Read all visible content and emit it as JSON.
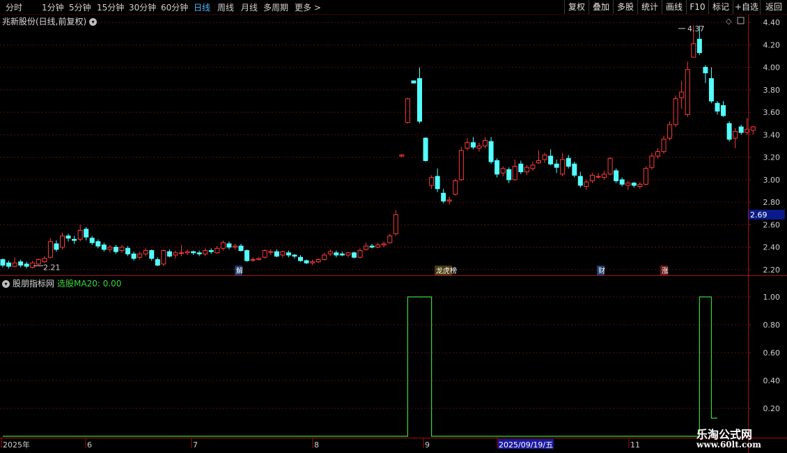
{
  "toolbar": {
    "periods": [
      "分时",
      "1分钟",
      "5分钟",
      "15分钟",
      "30分钟",
      "60分钟",
      "日线",
      "周线",
      "月线",
      "多周期",
      "更多 >"
    ],
    "active_period": "日线",
    "right_buttons": [
      "复权",
      "叠加",
      "多股",
      "统计",
      "画线",
      "F10",
      "标记",
      "+自选",
      "返回"
    ]
  },
  "main_chart": {
    "title": "兆新股份(日线,前复权)",
    "y_ticks": [
      "4.40",
      "4.20",
      "4.00",
      "3.80",
      "3.60",
      "3.40",
      "3.20",
      "3.00",
      "2.80",
      "2.60",
      "2.40",
      "2.20"
    ],
    "current_price": "2.69",
    "low_label": "2.21",
    "high_label": "4.37",
    "event_markers": [
      "解",
      "龙虎榜",
      "财",
      "涨"
    ]
  },
  "indicator": {
    "name": "股朋指标网",
    "value_label": "选股MA20: 0.00",
    "y_ticks": [
      "1.00",
      "0.80",
      "0.60",
      "0.40",
      "0.20"
    ]
  },
  "x_axis": {
    "labels": [
      "2025年",
      "6",
      "7",
      "8",
      "9",
      "2025/09/19/五",
      "11"
    ]
  },
  "watermark": {
    "line1": "乐淘公式网",
    "line2": "www.60lt.com"
  },
  "chart_data": [
    {
      "type": "candlestick",
      "title": "兆新股份(日线,前复权)",
      "ylim": [
        2.15,
        4.45
      ],
      "up_color": "#ff3b3b",
      "down_color": "#54ffff",
      "candles": [
        [
          2.29,
          2.24,
          2.3,
          2.22
        ],
        [
          2.26,
          2.23,
          2.28,
          2.21
        ],
        [
          2.23,
          2.26,
          2.31,
          2.22
        ],
        [
          2.27,
          2.24,
          2.29,
          2.22
        ],
        [
          2.25,
          2.23,
          2.27,
          2.21
        ],
        [
          2.22,
          2.26,
          2.28,
          2.21
        ],
        [
          2.25,
          2.29,
          2.3,
          2.24
        ],
        [
          2.27,
          2.3,
          2.32,
          2.26
        ],
        [
          2.31,
          2.45,
          2.48,
          2.3
        ],
        [
          2.43,
          2.38,
          2.46,
          2.36
        ],
        [
          2.4,
          2.5,
          2.53,
          2.38
        ],
        [
          2.5,
          2.48,
          2.52,
          2.45
        ],
        [
          2.47,
          2.46,
          2.5,
          2.43
        ],
        [
          2.47,
          2.55,
          2.6,
          2.45
        ],
        [
          2.56,
          2.49,
          2.58,
          2.46
        ],
        [
          2.48,
          2.44,
          2.5,
          2.42
        ],
        [
          2.45,
          2.41,
          2.47,
          2.39
        ],
        [
          2.42,
          2.38,
          2.44,
          2.36
        ],
        [
          2.38,
          2.4,
          2.42,
          2.35
        ],
        [
          2.4,
          2.36,
          2.42,
          2.34
        ],
        [
          2.37,
          2.4,
          2.42,
          2.35
        ],
        [
          2.39,
          2.34,
          2.41,
          2.32
        ],
        [
          2.34,
          2.3,
          2.36,
          2.28
        ],
        [
          2.31,
          2.34,
          2.36,
          2.29
        ],
        [
          2.34,
          2.37,
          2.39,
          2.32
        ],
        [
          2.37,
          2.3,
          2.38,
          2.28
        ],
        [
          2.29,
          2.24,
          2.31,
          2.23
        ],
        [
          2.25,
          2.37,
          2.38,
          2.23
        ],
        [
          2.36,
          2.32,
          2.38,
          2.31
        ],
        [
          2.33,
          2.35,
          2.37,
          2.3
        ],
        [
          2.35,
          2.35,
          2.42,
          2.32
        ],
        [
          2.35,
          2.36,
          2.38,
          2.33
        ],
        [
          2.36,
          2.35,
          2.37,
          2.33
        ],
        [
          2.35,
          2.34,
          2.37,
          2.32
        ],
        [
          2.34,
          2.37,
          2.39,
          2.32
        ],
        [
          2.37,
          2.36,
          2.39,
          2.34
        ],
        [
          2.35,
          2.39,
          2.41,
          2.34
        ],
        [
          2.39,
          2.44,
          2.46,
          2.37
        ],
        [
          2.43,
          2.4,
          2.45,
          2.38
        ],
        [
          2.4,
          2.41,
          2.43,
          2.38
        ],
        [
          2.41,
          2.37,
          2.43,
          2.36
        ],
        [
          2.37,
          2.28,
          2.38,
          2.27
        ],
        [
          2.29,
          2.29,
          2.31,
          2.27
        ],
        [
          2.29,
          2.3,
          2.31,
          2.28
        ],
        [
          2.31,
          2.37,
          2.38,
          2.3
        ],
        [
          2.36,
          2.36,
          2.38,
          2.33
        ],
        [
          2.36,
          2.32,
          2.38,
          2.31
        ],
        [
          2.33,
          2.36,
          2.37,
          2.31
        ],
        [
          2.35,
          2.33,
          2.37,
          2.31
        ],
        [
          2.33,
          2.32,
          2.34,
          2.3
        ],
        [
          2.31,
          2.28,
          2.33,
          2.27
        ],
        [
          2.28,
          2.26,
          2.29,
          2.25
        ],
        [
          2.26,
          2.27,
          2.29,
          2.24
        ],
        [
          2.27,
          2.29,
          2.3,
          2.26
        ],
        [
          2.29,
          2.33,
          2.35,
          2.28
        ],
        [
          2.34,
          2.36,
          2.38,
          2.32
        ],
        [
          2.35,
          2.33,
          2.37,
          2.31
        ],
        [
          2.34,
          2.33,
          2.36,
          2.32
        ],
        [
          2.33,
          2.35,
          2.36,
          2.31
        ],
        [
          2.35,
          2.31,
          2.36,
          2.3
        ],
        [
          2.31,
          2.37,
          2.39,
          2.3
        ],
        [
          2.38,
          2.41,
          2.44,
          2.37
        ],
        [
          2.41,
          2.4,
          2.43,
          2.39
        ],
        [
          2.4,
          2.42,
          2.44,
          2.39
        ],
        [
          2.42,
          2.43,
          2.45,
          2.4
        ],
        [
          2.44,
          2.5,
          2.52,
          2.43
        ],
        [
          2.52,
          2.69,
          2.73,
          2.5
        ],
        [
          3.21,
          3.22,
          3.23,
          3.2
        ],
        [
          3.51,
          3.72,
          3.73,
          3.5
        ],
        [
          3.88,
          3.86,
          3.88,
          3.86
        ],
        [
          3.9,
          3.52,
          4.0,
          3.5
        ],
        [
          3.37,
          3.17,
          3.38,
          3.16
        ],
        [
          2.95,
          3.02,
          3.04,
          2.92
        ],
        [
          3.03,
          2.92,
          3.1,
          2.89
        ],
        [
          2.88,
          2.81,
          2.92,
          2.79
        ],
        [
          2.81,
          2.82,
          2.85,
          2.78
        ],
        [
          2.87,
          2.99,
          3.01,
          2.86
        ],
        [
          3.0,
          3.26,
          3.29,
          2.99
        ],
        [
          3.28,
          3.33,
          3.37,
          3.26
        ],
        [
          3.33,
          3.29,
          3.38,
          3.27
        ],
        [
          3.28,
          3.3,
          3.33,
          3.25
        ],
        [
          3.3,
          3.35,
          3.38,
          3.28
        ],
        [
          3.34,
          3.16,
          3.38,
          3.14
        ],
        [
          3.17,
          3.05,
          3.19,
          3.02
        ],
        [
          3.06,
          3.1,
          3.12,
          3.03
        ],
        [
          3.09,
          3.0,
          3.11,
          2.97
        ],
        [
          3.0,
          3.12,
          3.18,
          2.99
        ],
        [
          3.14,
          3.07,
          3.17,
          3.05
        ],
        [
          3.07,
          3.11,
          3.13,
          3.04
        ],
        [
          3.1,
          3.13,
          3.16,
          3.08
        ],
        [
          3.15,
          3.17,
          3.26,
          3.14
        ],
        [
          3.18,
          3.22,
          3.24,
          3.15
        ],
        [
          3.21,
          3.14,
          3.27,
          3.13
        ],
        [
          3.14,
          3.11,
          3.18,
          3.06
        ],
        [
          3.05,
          3.18,
          3.24,
          3.03
        ],
        [
          3.19,
          3.12,
          3.22,
          3.1
        ],
        [
          3.14,
          3.04,
          3.16,
          3.02
        ],
        [
          3.03,
          2.95,
          3.07,
          2.93
        ],
        [
          2.94,
          2.98,
          3.0,
          2.91
        ],
        [
          2.99,
          3.04,
          3.06,
          2.97
        ],
        [
          3.03,
          3.03,
          3.06,
          3.01
        ],
        [
          3.02,
          3.05,
          3.08,
          3.0
        ],
        [
          3.05,
          3.19,
          3.2,
          3.04
        ],
        [
          3.08,
          2.99,
          3.1,
          2.97
        ],
        [
          3.0,
          2.96,
          3.02,
          2.94
        ],
        [
          2.95,
          2.97,
          2.99,
          2.91
        ],
        [
          2.97,
          2.95,
          2.98,
          2.93
        ],
        [
          2.94,
          2.96,
          2.98,
          2.92
        ],
        [
          2.96,
          3.1,
          3.12,
          2.95
        ],
        [
          3.11,
          3.21,
          3.24,
          3.09
        ],
        [
          3.21,
          3.25,
          3.28,
          3.19
        ],
        [
          3.25,
          3.36,
          3.39,
          3.23
        ],
        [
          3.37,
          3.49,
          3.52,
          3.35
        ],
        [
          3.49,
          3.72,
          3.75,
          3.47
        ],
        [
          3.73,
          3.78,
          3.88,
          3.63
        ],
        [
          3.58,
          3.98,
          4.05,
          3.56
        ],
        [
          4.09,
          4.21,
          4.37,
          4.09
        ],
        [
          4.25,
          4.13,
          4.37,
          4.11
        ],
        [
          4.0,
          3.95,
          4.02,
          3.86
        ],
        [
          3.9,
          3.7,
          4.0,
          3.68
        ],
        [
          3.68,
          3.61,
          3.7,
          3.58
        ],
        [
          3.66,
          3.57,
          3.7,
          3.56
        ],
        [
          3.5,
          3.36,
          3.52,
          3.34
        ],
        [
          3.37,
          3.43,
          3.46,
          3.28
        ],
        [
          3.47,
          3.42,
          3.49,
          3.4
        ],
        [
          3.42,
          3.45,
          3.55,
          3.4
        ],
        [
          3.44,
          3.47,
          3.48,
          3.4
        ]
      ]
    },
    {
      "type": "line",
      "name": "选股MA20",
      "ylim": [
        0,
        1.1
      ],
      "color": "#3bd63b",
      "segments": [
        [
          0,
          67,
          0
        ],
        [
          67,
          68,
          0
        ],
        [
          68,
          72,
          1
        ],
        [
          72,
          73,
          0
        ],
        [
          73,
          116,
          0
        ],
        [
          116,
          117,
          0
        ],
        [
          117,
          119,
          1
        ],
        [
          119,
          120,
          0.13
        ]
      ]
    }
  ]
}
